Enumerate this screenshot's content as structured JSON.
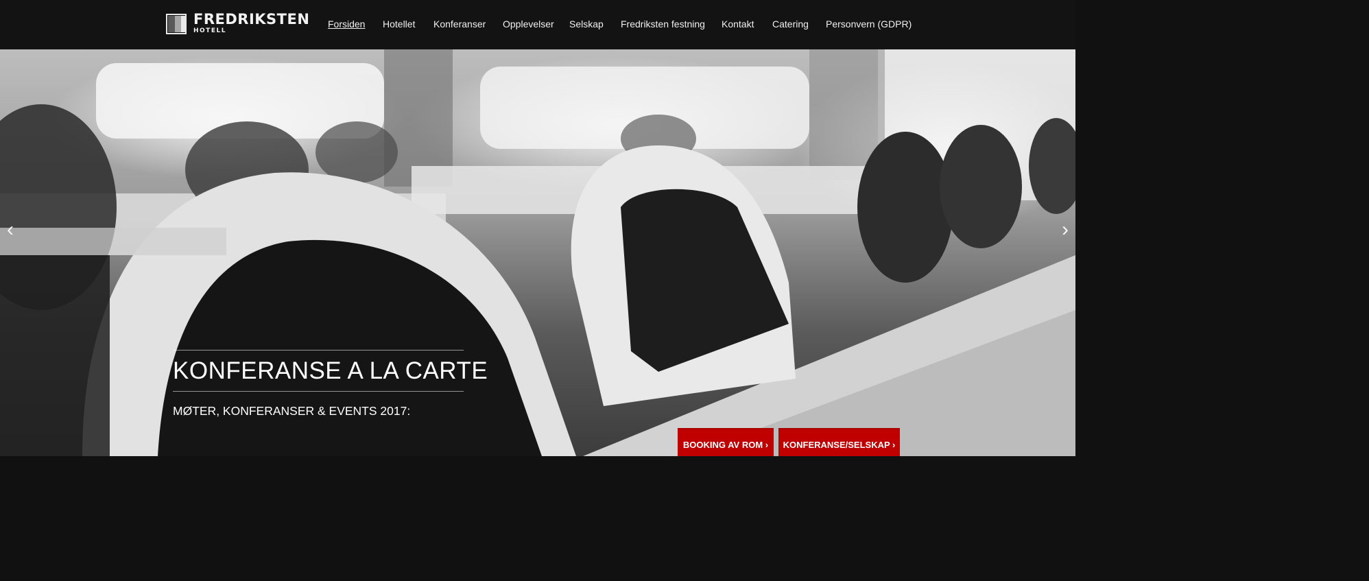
{
  "brand": {
    "name": "FREDRIKSTEN",
    "sub": "HOTELL"
  },
  "nav": [
    {
      "label": "Forsiden",
      "active": true
    },
    {
      "label": "Hotellet"
    },
    {
      "label": "Konferanser"
    },
    {
      "label": "Opplevelser"
    },
    {
      "label": "Selskap"
    },
    {
      "label": "Fredriksten festning"
    },
    {
      "label": "Kontakt"
    },
    {
      "label": "Catering"
    },
    {
      "label": "Personvern (GDPR)"
    }
  ],
  "hero": {
    "title": "KONFERANSE A LA CARTE",
    "subtitle": "MØTER, KONFERANSER & EVENTS 2017:",
    "prev_icon": "‹",
    "next_icon": "›"
  },
  "buttons": {
    "booking": "BOOKING AV ROM ›",
    "conference": "KONFERANSE/SELSKAP ›"
  },
  "colors": {
    "header_bg": "#131313",
    "accent_red": "#c00000"
  }
}
